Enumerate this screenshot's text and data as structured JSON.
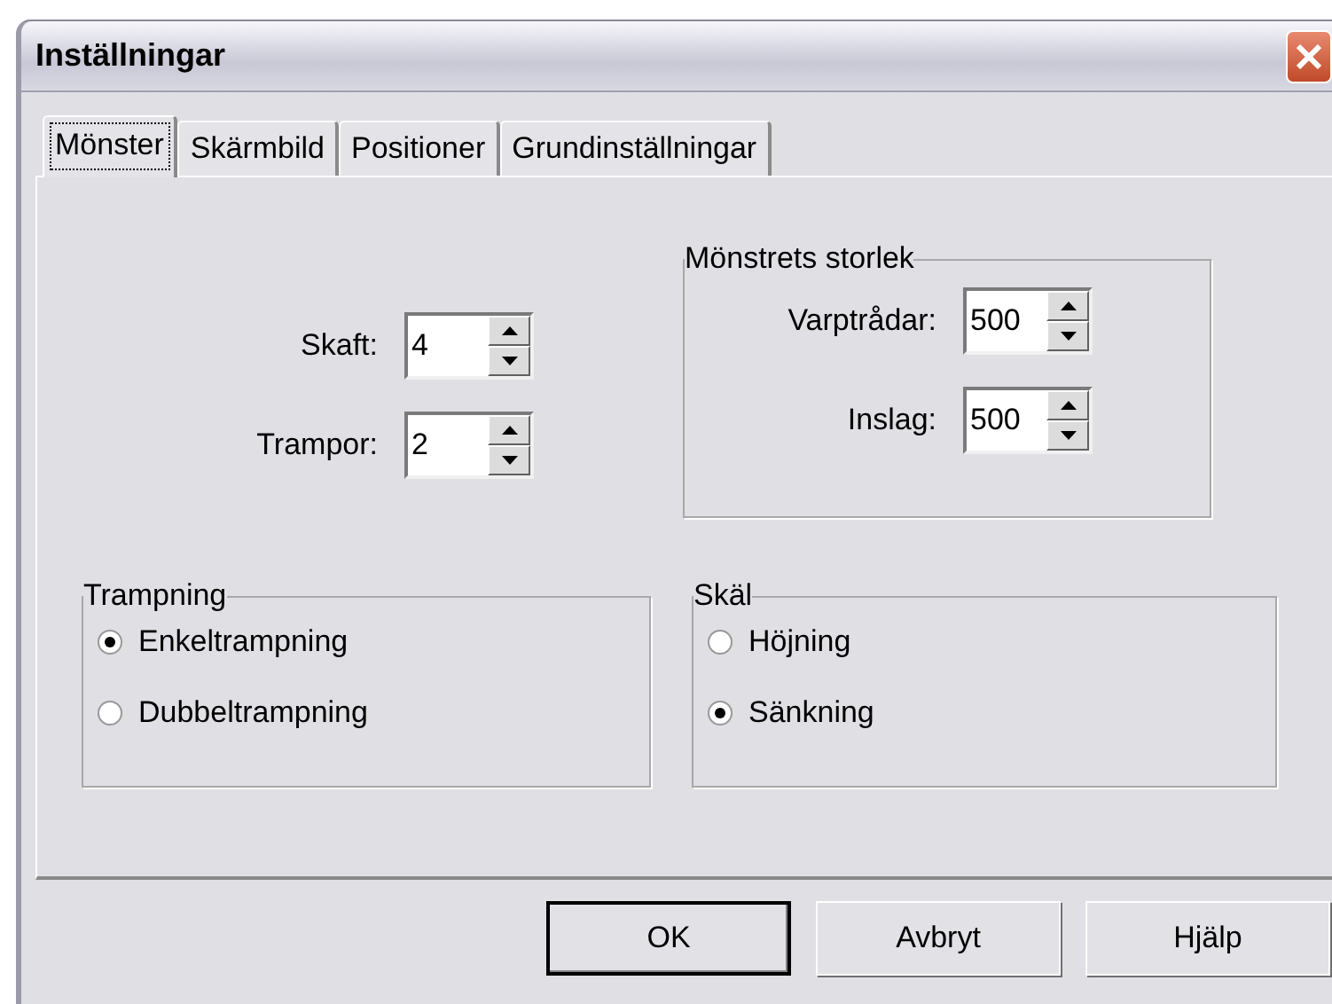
{
  "window": {
    "title": "Inställningar"
  },
  "tabs": [
    {
      "label": "Mönster",
      "selected": true
    },
    {
      "label": "Skärmbild",
      "selected": false
    },
    {
      "label": "Positioner",
      "selected": false
    },
    {
      "label": "Grundinställningar",
      "selected": false
    }
  ],
  "spinners": [
    {
      "label": "Skaft:",
      "value": "4"
    },
    {
      "label": "Trampor:",
      "value": "2"
    }
  ],
  "size_group": {
    "title": "Mönstrets storlek",
    "spinners": [
      {
        "label": "Varptrådar:",
        "value": "500"
      },
      {
        "label": "Inslag:",
        "value": "500"
      }
    ]
  },
  "radio_groups": [
    {
      "title": "Trampning",
      "options": [
        {
          "label": "Enkeltrampning",
          "selected": true
        },
        {
          "label": "Dubbeltrampning",
          "selected": false
        }
      ]
    },
    {
      "title": "Skäl",
      "options": [
        {
          "label": "Höjning",
          "selected": false
        },
        {
          "label": "Sänkning",
          "selected": true
        }
      ]
    }
  ],
  "buttons": [
    {
      "label": "OK",
      "default": true
    },
    {
      "label": "Avbryt",
      "default": false
    },
    {
      "label": "Hjälp",
      "default": false
    }
  ]
}
